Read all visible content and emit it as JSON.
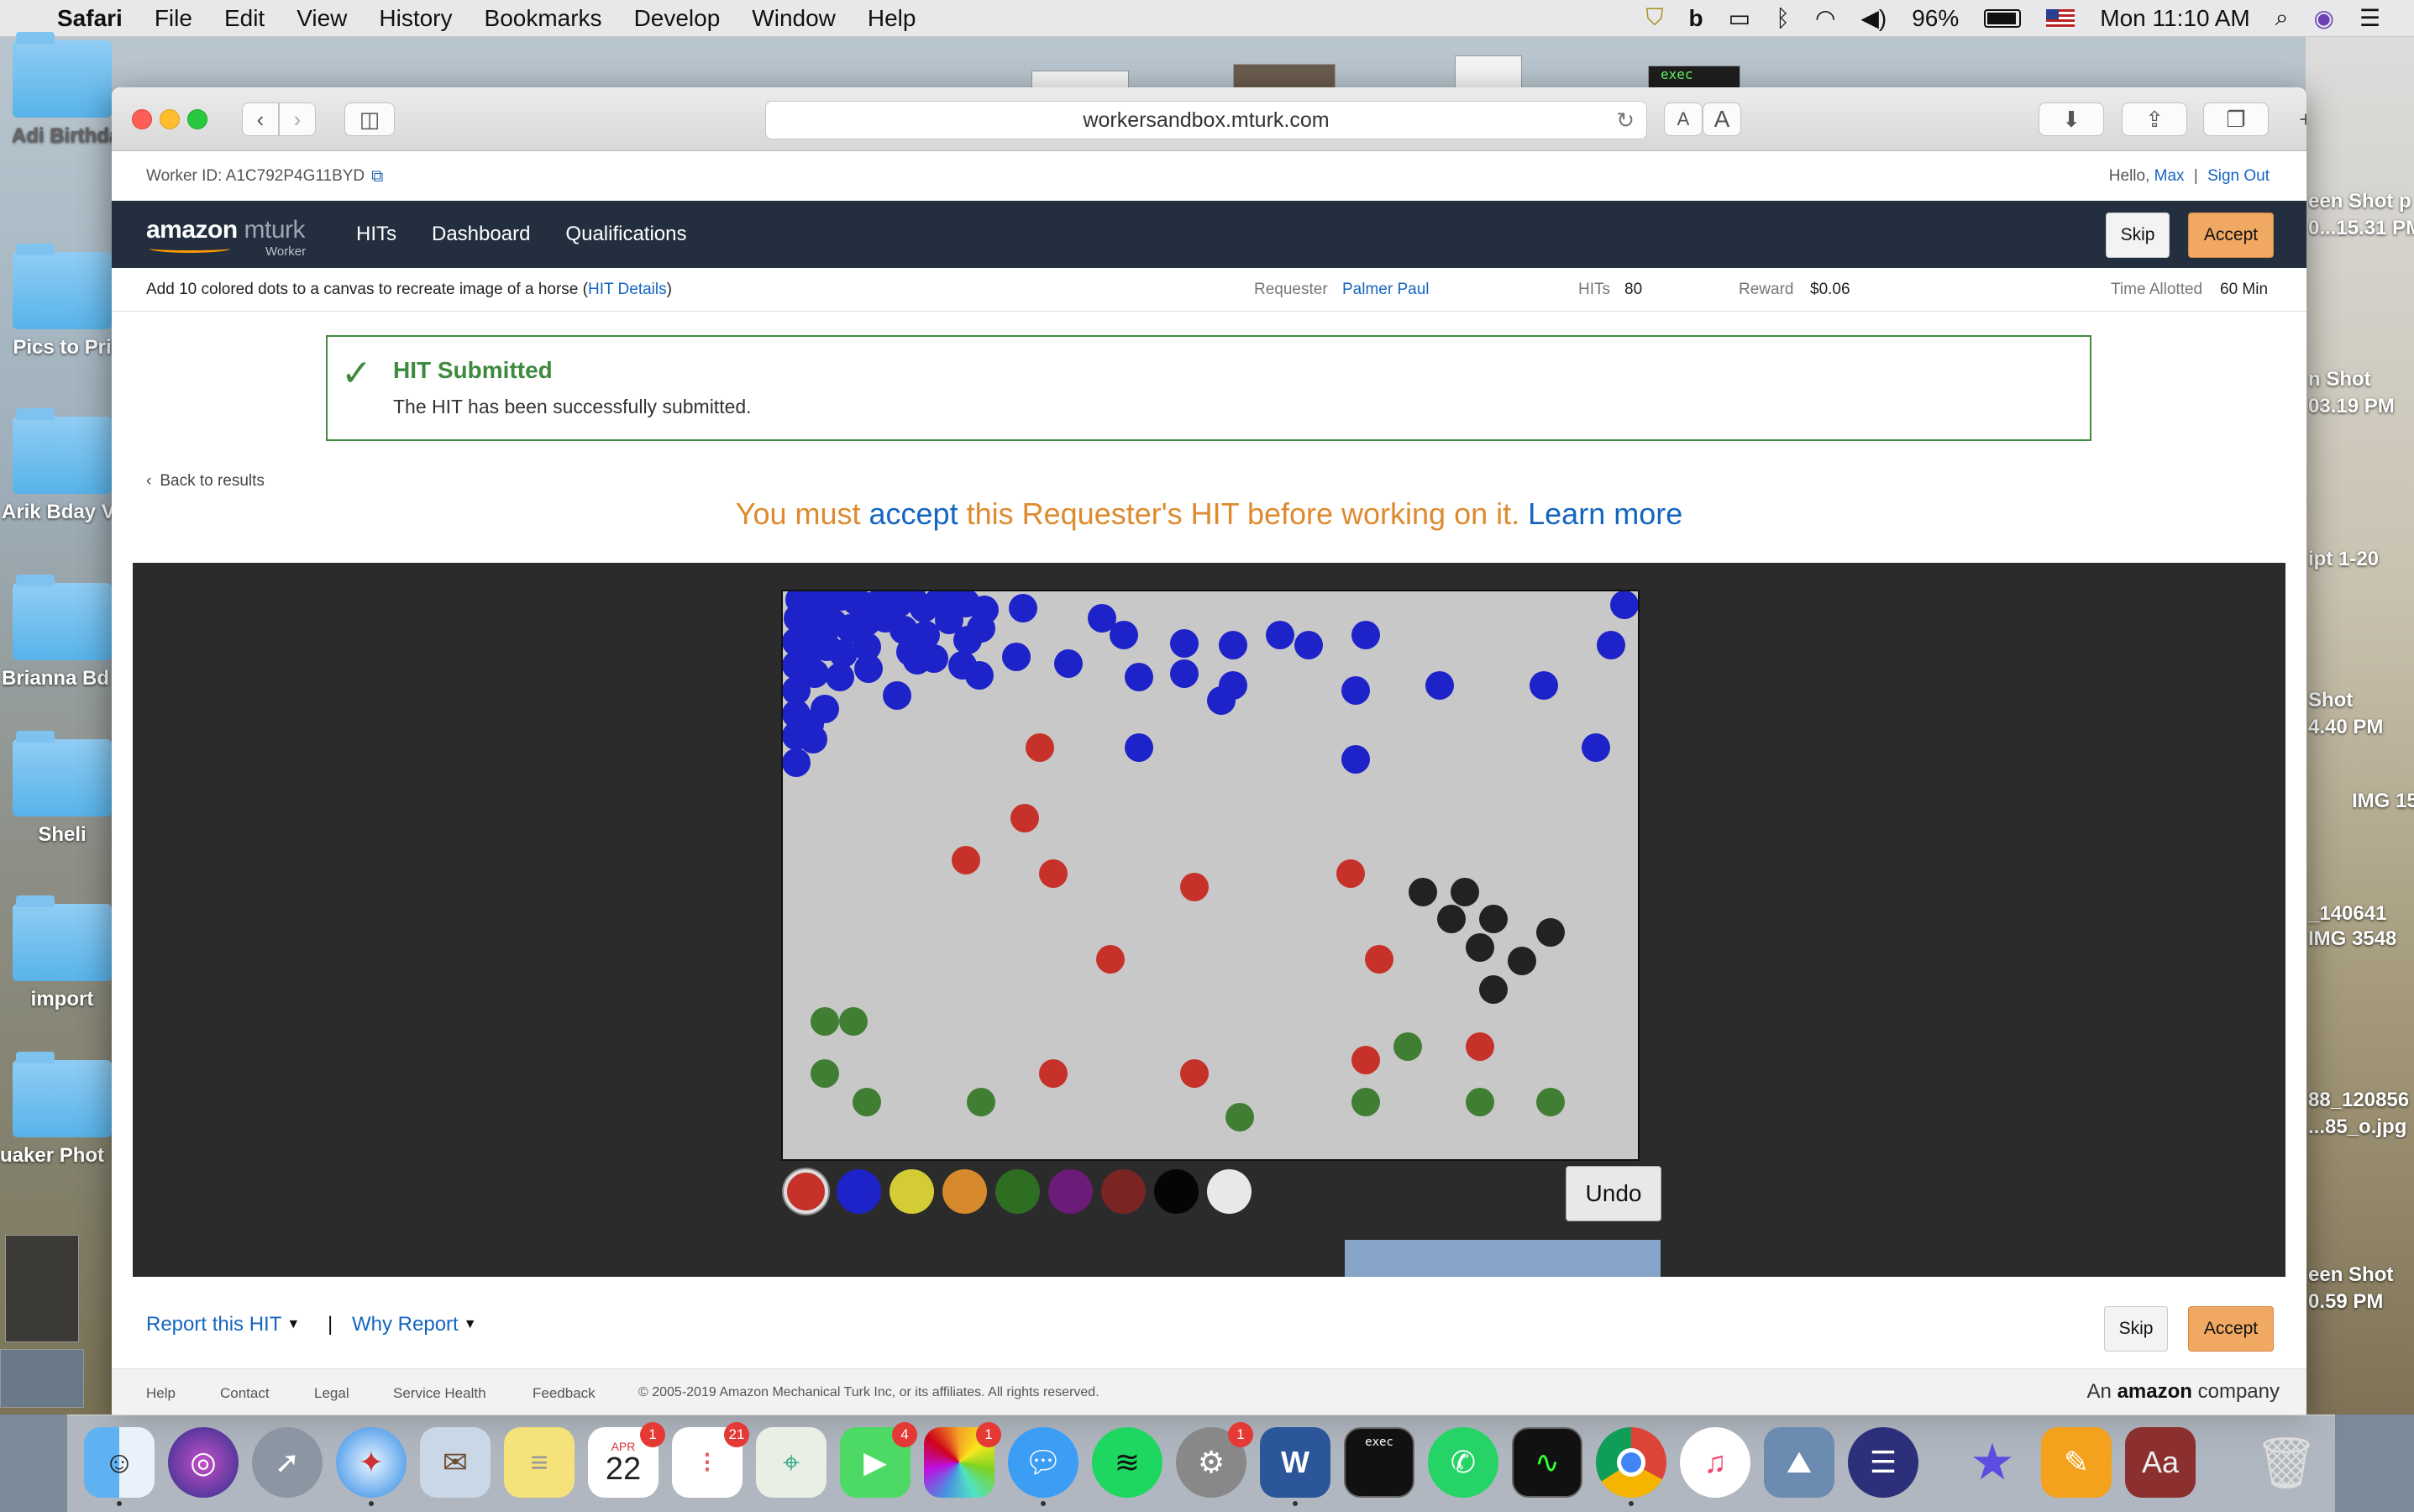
{
  "menubar": {
    "app_name": "Safari",
    "items": [
      "File",
      "Edit",
      "View",
      "History",
      "Bookmarks",
      "Develop",
      "Window",
      "Help"
    ],
    "battery": "96%",
    "clock": "Mon 11:10 AM"
  },
  "desktop": {
    "left_labels": [
      "Adi Birthda",
      "Pics to Pri",
      "Arik Bday V",
      "Brianna Bd",
      "Sheli",
      "import",
      "uaker Phot"
    ],
    "right_labels": [
      "een Shot p",
      "0...15.31 PM",
      "n Shot",
      "03.19 PM",
      "ipt 1-20",
      "Shot",
      "4.40 PM",
      "IMG 15",
      "_140641",
      "IMG 3548",
      "88_120856",
      "...85_o.jpg",
      "een Shot",
      "0.59 PM"
    ],
    "terminal_thumb": "exec"
  },
  "browser": {
    "url": "workersandbox.mturk.com",
    "text_small": "A",
    "text_large": "A"
  },
  "account": {
    "worker_id": "Worker ID: A1C792P4G11BYD",
    "hello": "Hello,",
    "user": "Max",
    "separator": "|",
    "sign_out": "Sign Out"
  },
  "nav": {
    "logo_main": "amazon",
    "logo_sub": "mturk",
    "logo_worker": "Worker",
    "links": [
      "HITs",
      "Dashboard",
      "Qualifications"
    ],
    "skip": "Skip",
    "accept": "Accept"
  },
  "hit": {
    "title": "Add 10 colored dots to a canvas to recreate image of a horse",
    "details_open": "(",
    "details_link": "HIT Details",
    "details_close": ")",
    "requester_label": "Requester",
    "requester": "Palmer Paul",
    "hits_label": "HITs",
    "hits": "80",
    "reward_label": "Reward",
    "reward": "$0.06",
    "time_label": "Time Allotted",
    "time": "60 Min"
  },
  "alert": {
    "title": "HIT Submitted",
    "message": "The HIT has been successfully submitted."
  },
  "back": "Back to results",
  "notice": {
    "part1": "You must",
    "accept_link": "accept",
    "part2": "this Requester's HIT before working on it.",
    "learn_more": "Learn more"
  },
  "palette": [
    {
      "name": "red",
      "color": "#c6312a",
      "selected": true
    },
    {
      "name": "blue",
      "color": "#1d23c8"
    },
    {
      "name": "yellow",
      "color": "#d4cc35"
    },
    {
      "name": "orange",
      "color": "#d78a2c"
    },
    {
      "name": "green",
      "color": "#2e6e22"
    },
    {
      "name": "purple",
      "color": "#6b1b78"
    },
    {
      "name": "dark-red",
      "color": "#7a2424"
    },
    {
      "name": "black",
      "color": "#050505"
    },
    {
      "name": "white",
      "color": "#e8e8e8"
    }
  ],
  "undo": "Undo",
  "footer_actions": {
    "report": "Report this HIT",
    "sep": "|",
    "why": "Why Report",
    "skip": "Skip",
    "accept": "Accept"
  },
  "footer": {
    "links": [
      "Help",
      "Contact",
      "Legal",
      "Service Health",
      "Feedback"
    ],
    "copyright": "© 2005-2019 Amazon Mechanical Turk Inc, or its affiliates. All rights reserved.",
    "company_prefix": "An",
    "company_brand": "amazon",
    "company_suffix": "company"
  },
  "dock": {
    "calendar_month": "APR",
    "calendar_day": "22",
    "badges": {
      "calendar": "1",
      "reminders": "21",
      "facetime": "4",
      "photos": "1",
      "system_prefs": "1"
    },
    "terminal_label": "exec",
    "word_label": "W",
    "dictionary_label": "Aa"
  }
}
